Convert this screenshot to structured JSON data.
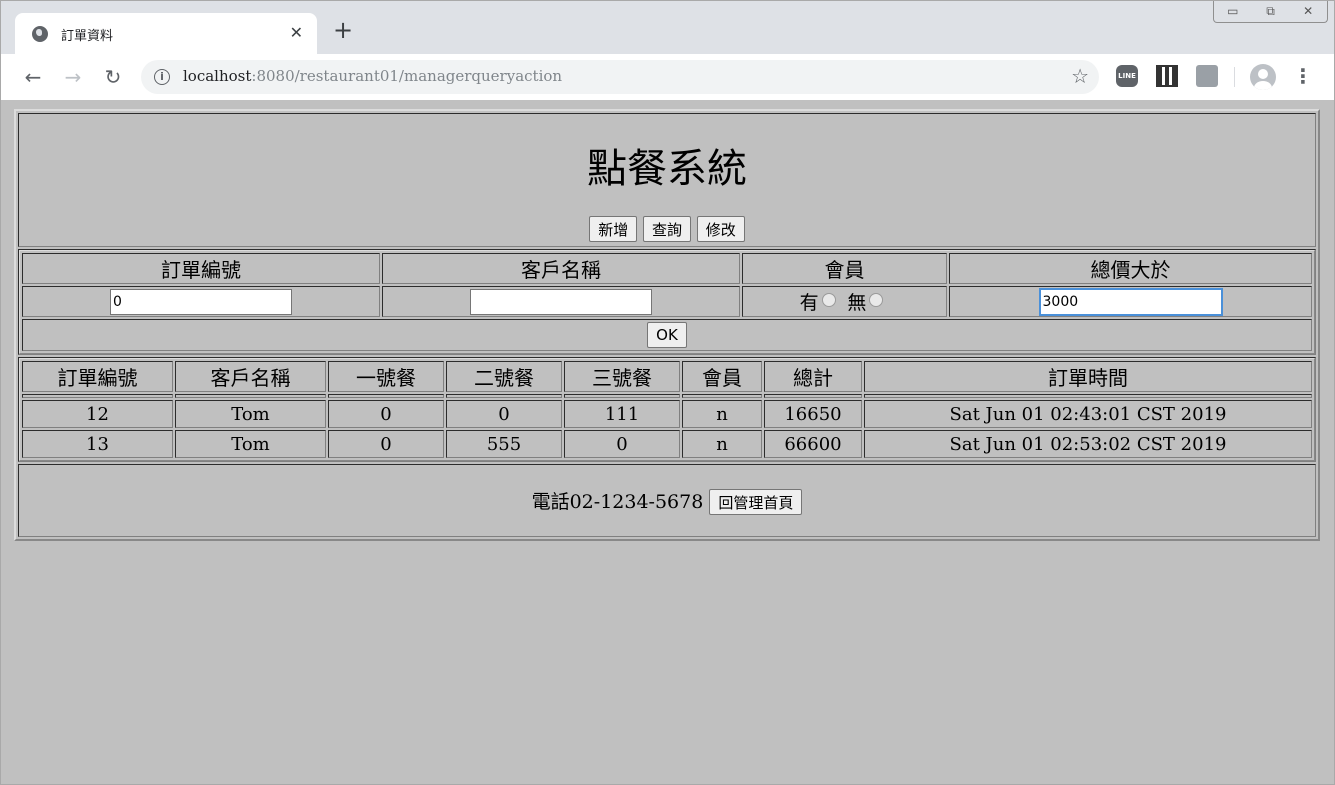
{
  "browser": {
    "tab_title": "訂單資料",
    "tab_close": "✕",
    "new_tab": "+",
    "url_host": "localhost",
    "url_path": ":8080/restaurant01/managerqueryaction",
    "back": "←",
    "forward": "→",
    "reload": "↻",
    "info": "i",
    "star": "☆",
    "ext_line": "LINE",
    "menu": "⋮",
    "win_minimize": "▭",
    "win_restore": "⧉",
    "win_close": "✕"
  },
  "header": {
    "title": "點餐系統",
    "buttons": [
      "新增",
      "查詢",
      "修改"
    ]
  },
  "query": {
    "columns": [
      "訂單編號",
      "客戶名稱",
      "會員",
      "總價大於"
    ],
    "order_id_value": "0",
    "customer_value": "",
    "member_yes": "有",
    "member_no": "無",
    "total_value": "3000",
    "ok_label": "OK"
  },
  "results": {
    "columns": [
      "訂單編號",
      "客戶名稱",
      "一號餐",
      "二號餐",
      "三號餐",
      "會員",
      "總計",
      "訂單時間"
    ],
    "rows": [
      [
        "12",
        "Tom",
        "0",
        "0",
        "111",
        "n",
        "16650",
        "Sat Jun 01 02:43:01 CST 2019"
      ],
      [
        "13",
        "Tom",
        "0",
        "555",
        "0",
        "n",
        "66600",
        "Sat Jun 01 02:53:02 CST 2019"
      ]
    ]
  },
  "footer": {
    "phone": "電話02-1234-5678",
    "home_button": "回管理首頁"
  }
}
